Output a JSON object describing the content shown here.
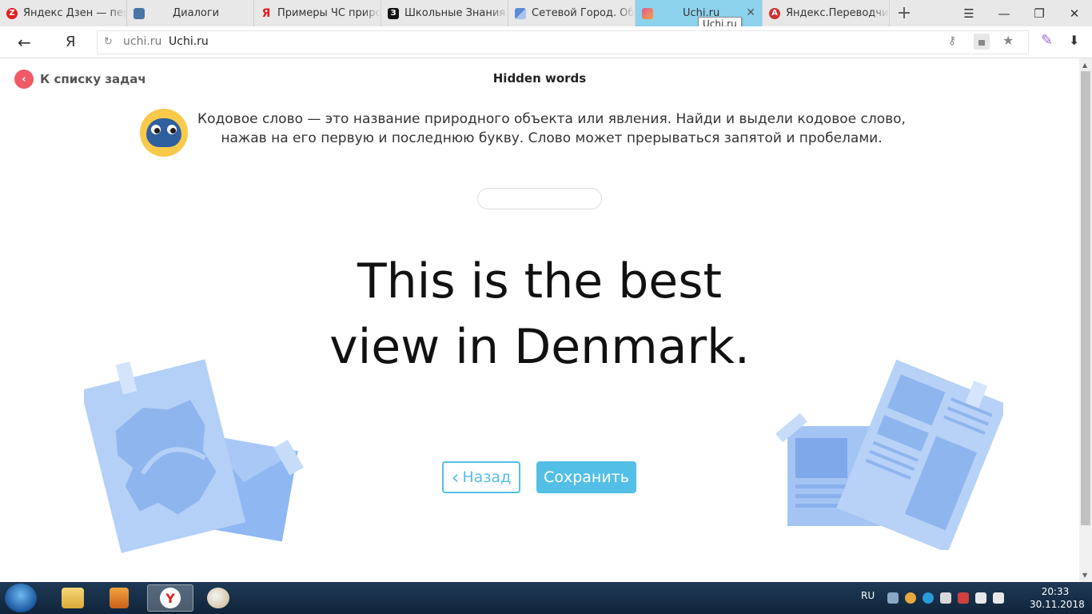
{
  "browser": {
    "tabs": [
      {
        "label": "Яндекс Дзен — перс",
        "icon": "yandex-zen-icon",
        "color": "#e02020",
        "glyph": "Z"
      },
      {
        "label": "Диалоги",
        "icon": "chat-icon",
        "color": "#4a76a8",
        "glyph": ""
      },
      {
        "label": "Примеры ЧС приро",
        "icon": "yandex-icon",
        "color": "#e8e8e8",
        "glyph": "Я"
      },
      {
        "label": "Школьные Знания.c",
        "icon": "znanija-icon",
        "color": "#111111",
        "glyph": "З"
      },
      {
        "label": "Сетевой Город. Обр",
        "icon": "netcity-icon",
        "color": "#5b8ad6",
        "glyph": ""
      },
      {
        "label": "Uchi.ru",
        "icon": "uchi-icon",
        "color": "#e05a9a",
        "glyph": ""
      },
      {
        "label": "Яндекс.Переводчик",
        "icon": "translate-icon",
        "color": "#d03030",
        "glyph": "A"
      }
    ],
    "active_tab_tooltip": "Uchi.ru",
    "tab_close_glyph": "✕",
    "new_tab_glyph": "+",
    "window_controls": [
      "☰",
      "—",
      "❐",
      "✕"
    ],
    "address": {
      "domain": "uchi.ru",
      "title": "Uchi.ru"
    },
    "nav_glyphs": {
      "back": "←",
      "logo": "Я",
      "reload": "↻",
      "key": "⚷",
      "star": "★",
      "pen": "✎",
      "download": "⬇"
    }
  },
  "page": {
    "back_link": "К списку задач",
    "back_link_glyph": "‹",
    "title": "Hidden words",
    "instruction": "Кодовое слово — это название природного объекта или явления. Найди и выдели кодовое слово, нажав на его первую и последнюю букву. Слово может прерываться запятой и пробелами.",
    "sentence_line1": "This is the best",
    "sentence_line2": "view in Denmark.",
    "btn_back": "Назад",
    "btn_back_glyph": "‹",
    "btn_save": "Сохранить",
    "accent_color": "#54bfe6"
  },
  "taskbar": {
    "language": "RU",
    "time": "20:33",
    "date": "30.11.2018",
    "apps": [
      "explorer-icon",
      "media-player-icon",
      "yandex-browser-icon",
      "paint-icon"
    ]
  }
}
